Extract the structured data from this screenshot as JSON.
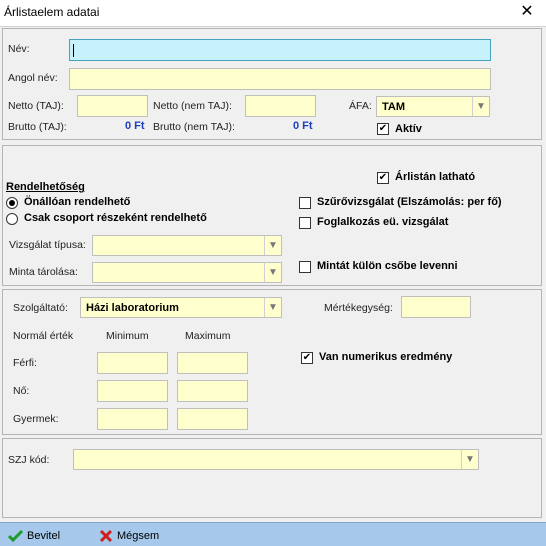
{
  "window": {
    "title": "Árlistaelem adatai"
  },
  "general": {
    "name_label": "Név:",
    "name_value": "",
    "english_name_label": "Angol név:",
    "english_name_value": "",
    "netto_taj_label": "Netto (TAJ):",
    "netto_nem_taj_label": "Netto (nem TAJ):",
    "brutto_taj_label": "Brutto (TAJ):",
    "brutto_taj_value": "0 Ft",
    "brutto_nem_taj_label": "Brutto (nem TAJ):",
    "brutto_nem_taj_value": "0 Ft",
    "afa_label": "ÁFA:",
    "afa_value": "TAM",
    "aktiv_label": "Aktív",
    "aktiv_checked": true
  },
  "orderability": {
    "title": "Rendelhetőség",
    "radio_independent": "Önállóan rendelhető",
    "radio_group_only": "Csak csoport részeként rendelhető",
    "selected": "independent",
    "exam_type_label": "Vizsgálat típusa:",
    "exam_type_value": "",
    "sample_storage_label": "Minta tárolása:",
    "sample_storage_value": "",
    "visible_on_pricelist_label": "Árlistán latható",
    "visible_on_pricelist_checked": true,
    "screening_label": "Szűrővizsgálat (Elszámolás: per fő)",
    "screening_checked": false,
    "occupational_label": "Foglalkozás eü. vizsgálat",
    "occupational_checked": false,
    "separate_tube_label": "Mintát külön csőbe levenni",
    "separate_tube_checked": false
  },
  "provider": {
    "provider_label": "Szolgáltató:",
    "provider_value": "Házi laboratorium",
    "unit_label": "Mértékegység:",
    "unit_value": "",
    "normal_label": "Normál érték",
    "min_label": "Minimum",
    "max_label": "Maximum",
    "rows": [
      {
        "label": "Férfi:"
      },
      {
        "label": "Nő:"
      },
      {
        "label": "Gyermek:"
      }
    ],
    "numeric_label": "Van numerikus eredmény",
    "numeric_checked": true
  },
  "szj": {
    "label": "SZJ kód:",
    "value": ""
  },
  "footer": {
    "save_label": "Bevitel",
    "cancel_label": "Mégsem"
  },
  "colors": {
    "input_bg": "#ffffcd",
    "focus_bg": "#c7f2fb",
    "footer_bg": "#a6c8ea",
    "money": "#1a3fbf"
  },
  "icons": {
    "close": "close-icon",
    "save": "checkmark-icon",
    "cancel": "x-icon"
  }
}
